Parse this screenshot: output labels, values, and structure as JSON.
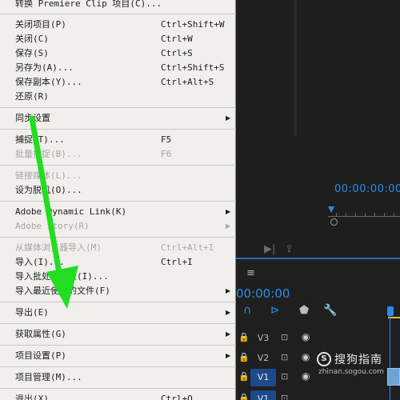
{
  "menu": {
    "items": [
      {
        "label": "转换 Premiere Clip 项目(C)...",
        "shortcut": "",
        "submenu": false,
        "disabled": false
      },
      {
        "label": "关闭项目(P)",
        "shortcut": "Ctrl+Shift+W",
        "submenu": false,
        "disabled": false
      },
      {
        "label": "关闭(C)",
        "shortcut": "Ctrl+W",
        "submenu": false,
        "disabled": false
      },
      {
        "label": "保存(S)",
        "shortcut": "Ctrl+S",
        "submenu": false,
        "disabled": false
      },
      {
        "label": "另存为(A)...",
        "shortcut": "Ctrl+Shift+S",
        "submenu": false,
        "disabled": false
      },
      {
        "label": "保存副本(Y)...",
        "shortcut": "Ctrl+Alt+S",
        "submenu": false,
        "disabled": false
      },
      {
        "label": "还原(R)",
        "shortcut": "",
        "submenu": false,
        "disabled": false
      },
      {
        "label": "同步设置",
        "shortcut": "",
        "submenu": true,
        "disabled": false
      },
      {
        "label": "捕捉(T)...",
        "shortcut": "F5",
        "submenu": false,
        "disabled": false
      },
      {
        "label": "批量捕捉(B)...",
        "shortcut": "F6",
        "submenu": false,
        "disabled": true
      },
      {
        "label": "链接媒体(L)...",
        "shortcut": "",
        "submenu": false,
        "disabled": true
      },
      {
        "label": "设为脱机(O)...",
        "shortcut": "",
        "submenu": false,
        "disabled": false
      },
      {
        "label": "Adobe Dynamic Link(K)",
        "shortcut": "",
        "submenu": true,
        "disabled": false
      },
      {
        "label": "Adobe Story(R)",
        "shortcut": "",
        "submenu": true,
        "disabled": true
      },
      {
        "label": "从媒体浏览器导入(M)",
        "shortcut": "Ctrl+Alt+I",
        "submenu": false,
        "disabled": true
      },
      {
        "label": "导入(I)...",
        "shortcut": "Ctrl+I",
        "submenu": false,
        "disabled": false
      },
      {
        "label": "导入批处理列表(I)...",
        "shortcut": "",
        "submenu": false,
        "disabled": false
      },
      {
        "label": "导入最近使用的文件(F)",
        "shortcut": "",
        "submenu": true,
        "disabled": false
      },
      {
        "label": "导出(E)",
        "shortcut": "",
        "submenu": true,
        "disabled": false
      },
      {
        "label": "获取属性(G)",
        "shortcut": "",
        "submenu": true,
        "disabled": false
      },
      {
        "label": "项目设置(P)",
        "shortcut": "",
        "submenu": true,
        "disabled": false
      },
      {
        "label": "项目管理(M)...",
        "shortcut": "",
        "submenu": false,
        "disabled": false
      },
      {
        "label": "退出(X)",
        "shortcut": "Ctrl+Q",
        "submenu": false,
        "disabled": false
      }
    ],
    "submenu_arrow": "▶"
  },
  "monitor": {
    "timecode": "00:00:00:00"
  },
  "timeline": {
    "menu_icon": "≡",
    "timecode": "00:00:00",
    "tracks": [
      {
        "name": "V3",
        "active": false
      },
      {
        "name": "V2",
        "active": false
      },
      {
        "name": "V1",
        "active": true
      },
      {
        "name": "V1",
        "active": true
      }
    ]
  },
  "watermark": {
    "logo": "S",
    "name": "搜狗指南",
    "url": "zhinan.sogou.com"
  },
  "colors": {
    "menu_bg": "#f0efec",
    "accent_blue": "#2d8ceb",
    "arrow_green": "#22dd22"
  }
}
